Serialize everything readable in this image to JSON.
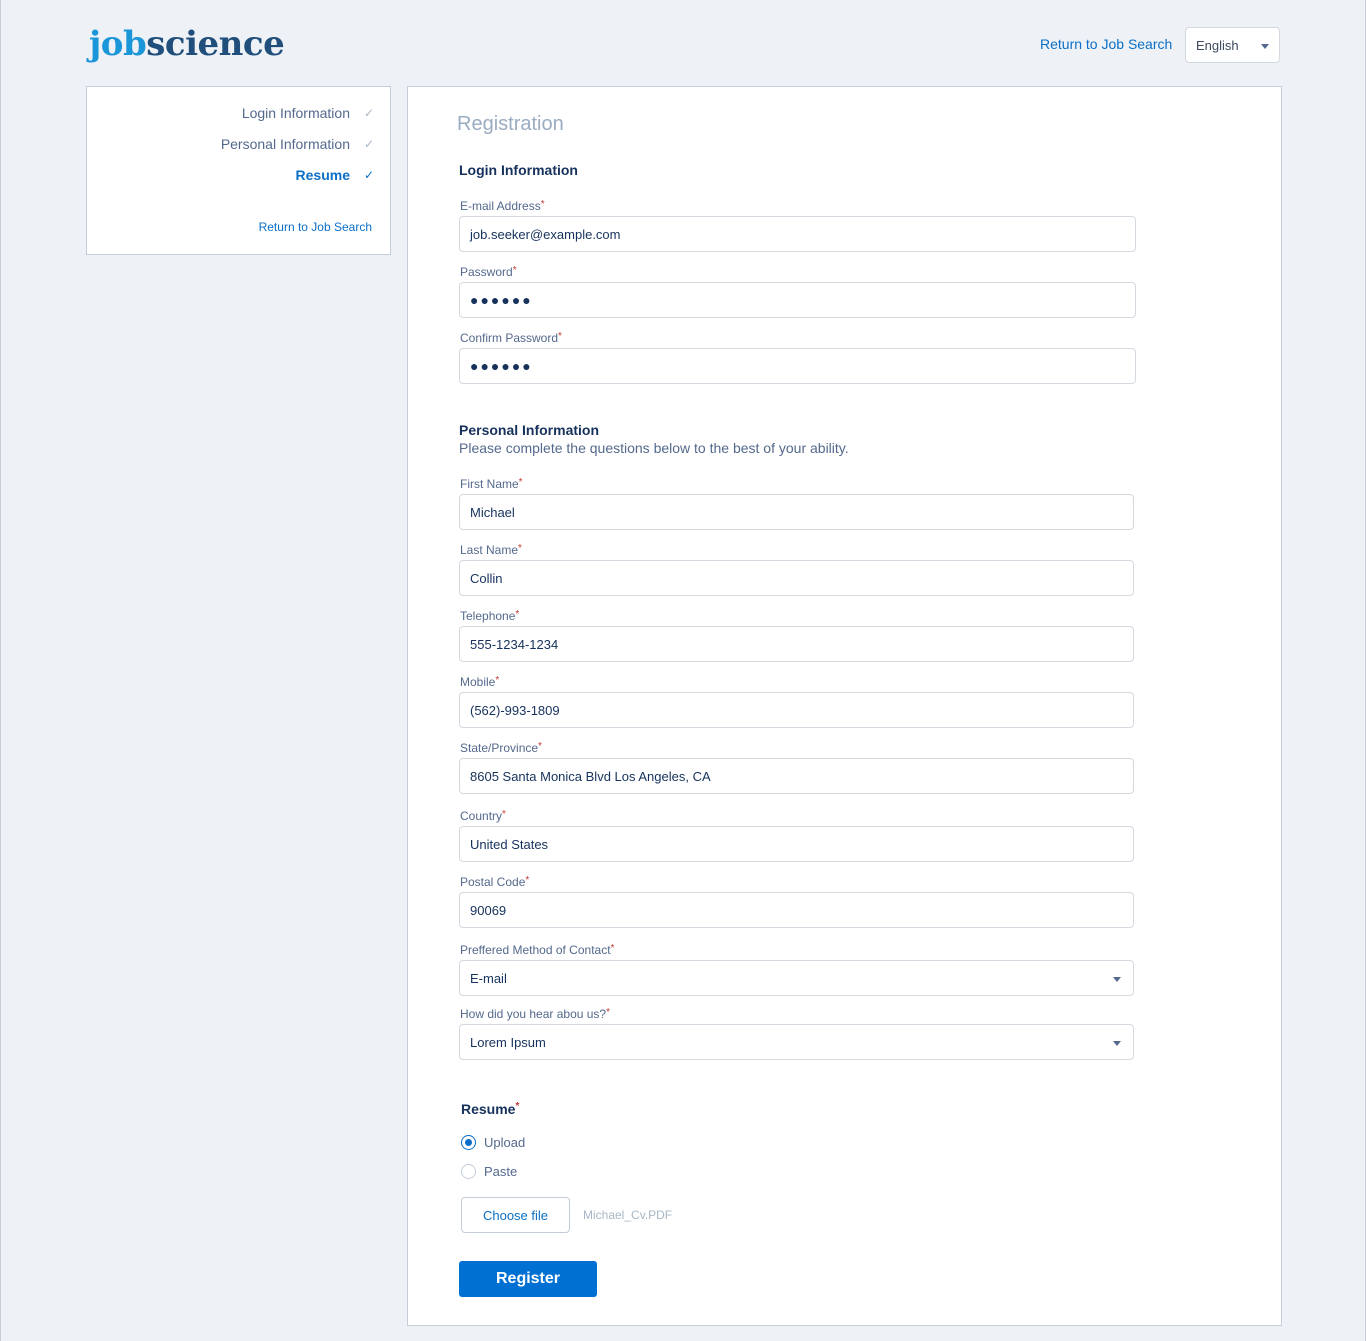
{
  "header": {
    "logo_part1": "job",
    "logo_part2": "science",
    "return_link": "Return to Job Search",
    "language": "English"
  },
  "sidebar": {
    "steps": [
      {
        "label": "Login Information",
        "check": "✓"
      },
      {
        "label": "Personal Information",
        "check": "✓"
      },
      {
        "label": "Resume",
        "check": "✓"
      }
    ],
    "return_link": "Return to Job Search"
  },
  "form": {
    "title": "Registration",
    "login_section": "Login Information",
    "email": {
      "label": "E-mail Address",
      "value": "job.seeker@example.com"
    },
    "password": {
      "label": "Password",
      "value": "●●●●●●"
    },
    "confirm_password": {
      "label": "Confirm Password",
      "value": "●●●●●●"
    },
    "personal_section": "Personal Information",
    "personal_subtitle": "Please complete the questions below to the best of your ability.",
    "first_name": {
      "label": "First Name",
      "value": "Michael"
    },
    "last_name": {
      "label": "Last Name",
      "value": "Collin"
    },
    "telephone": {
      "label": "Telephone",
      "value": "555-1234-1234"
    },
    "mobile": {
      "label": "Mobile",
      "value": "(562)-993-1809"
    },
    "state": {
      "label": "State/Province",
      "value": "8605 Santa Monica Blvd Los Angeles, CA"
    },
    "country": {
      "label": "Country",
      "value": "United States"
    },
    "postal": {
      "label": "Postal Code",
      "value": "90069"
    },
    "contact_method": {
      "label": "Preffered Method of Contact",
      "value": "E-mail"
    },
    "heard_about": {
      "label": "How did you hear abou us?",
      "value": "Lorem Ipsum"
    },
    "required_mark": "*",
    "resume": {
      "label": "Resume",
      "option_upload": "Upload",
      "option_paste": "Paste",
      "choose_file": "Choose file",
      "file_name": "Michael_Cv.PDF"
    },
    "register": "Register"
  },
  "colors": {
    "accent": "#0070d2",
    "background": "#eef1f6",
    "required": "#c23934"
  }
}
